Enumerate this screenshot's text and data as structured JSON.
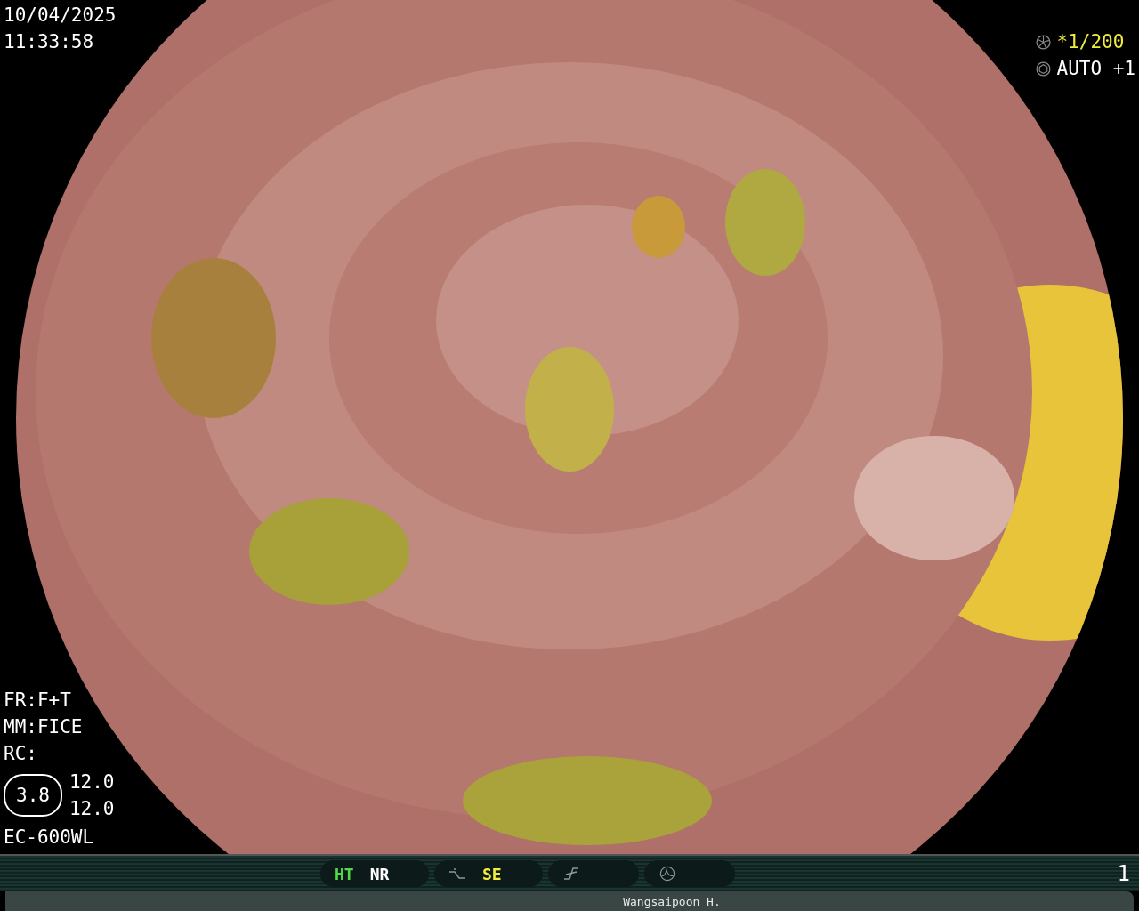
{
  "datetime": {
    "date": "10/04/2025",
    "time": "11:33:58"
  },
  "exposure": [
    {
      "kind": "shutter",
      "value": "*1/200",
      "color": "#f2ec3c"
    },
    {
      "kind": "iris",
      "value": "AUTO +1",
      "color": "#ffffff"
    }
  ],
  "settings": [
    "FR:F+T",
    "MM:FICE",
    "RC:"
  ],
  "zoom": {
    "value": "3.8",
    "readings": [
      "12.0",
      "12.0"
    ]
  },
  "scope_model": "EC-600WL",
  "mode_groups": [
    {
      "kind": "text",
      "items": [
        {
          "label": "HT",
          "color": "#52d84a"
        },
        {
          "label": "NR",
          "color": "#ffffff"
        }
      ]
    },
    {
      "kind": "curve",
      "items": [
        {
          "label": "SE",
          "color": "#f2ec3c"
        }
      ]
    },
    {
      "kind": "slash"
    },
    {
      "kind": "wave"
    }
  ],
  "image_number": "1",
  "patient_name": "Wangsaipoon H."
}
